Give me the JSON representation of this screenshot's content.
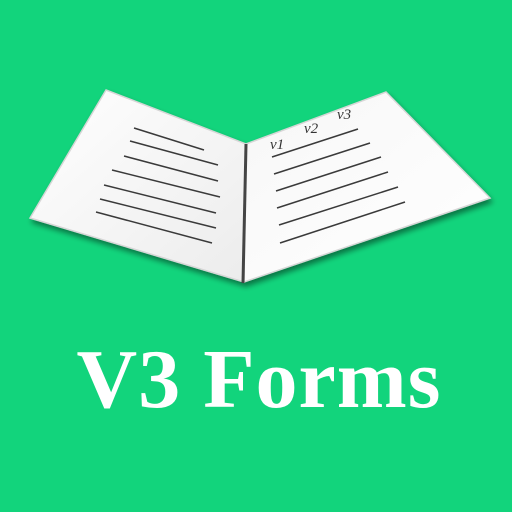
{
  "app": {
    "title": "V3 Forms",
    "background_color": "#12d47c",
    "title_color": "#ffffff"
  },
  "logo": {
    "icon": "open-book-form-icon",
    "column_labels": [
      "v1",
      "v2",
      "v3"
    ],
    "left_page_line_count": 7,
    "right_page_line_count": 6
  }
}
